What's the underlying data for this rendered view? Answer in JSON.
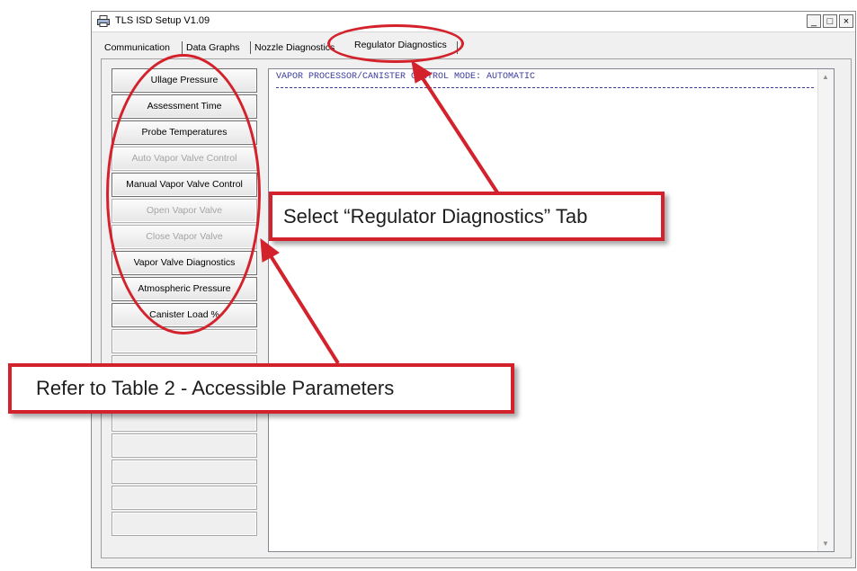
{
  "window": {
    "title": "TLS ISD Setup V1.09",
    "controls": {
      "minimize": "_",
      "maximize": "□",
      "close": "×"
    }
  },
  "tabs": [
    {
      "label": "Communication"
    },
    {
      "label": "Data Graphs"
    },
    {
      "label": "Nozzle Diagnostics"
    },
    {
      "label": "Regulator Diagnostics",
      "active": true
    }
  ],
  "buttons": [
    {
      "label": "Ullage Pressure",
      "enabled": true
    },
    {
      "label": "Assessment Time",
      "enabled": true
    },
    {
      "label": "Probe Temperatures",
      "enabled": true
    },
    {
      "label": "Auto Vapor Valve Control",
      "enabled": false
    },
    {
      "label": "Manual Vapor Valve Control",
      "enabled": true
    },
    {
      "label": "Open Vapor Valve",
      "enabled": false
    },
    {
      "label": "Close Vapor Valve",
      "enabled": false
    },
    {
      "label": "Vapor Valve Diagnostics",
      "enabled": true
    },
    {
      "label": "Atmospheric Pressure",
      "enabled": true
    },
    {
      "label": "Canister Load %",
      "enabled": true
    },
    {
      "label": ""
    },
    {
      "label": ""
    },
    {
      "label": ""
    },
    {
      "label": ""
    },
    {
      "label": ""
    },
    {
      "label": ""
    },
    {
      "label": ""
    },
    {
      "label": ""
    }
  ],
  "output": {
    "line": "VAPOR PROCESSOR/CANISTER CONTROL MODE: AUTOMATIC"
  },
  "callouts": {
    "regulator_tab": "Select “Regulator Diagnostics” Tab",
    "accessible_params": "Refer to Table 2 - Accessible Parameters"
  },
  "colors": {
    "annotation_red": "#d3222b",
    "output_text": "#3b3b9c"
  }
}
